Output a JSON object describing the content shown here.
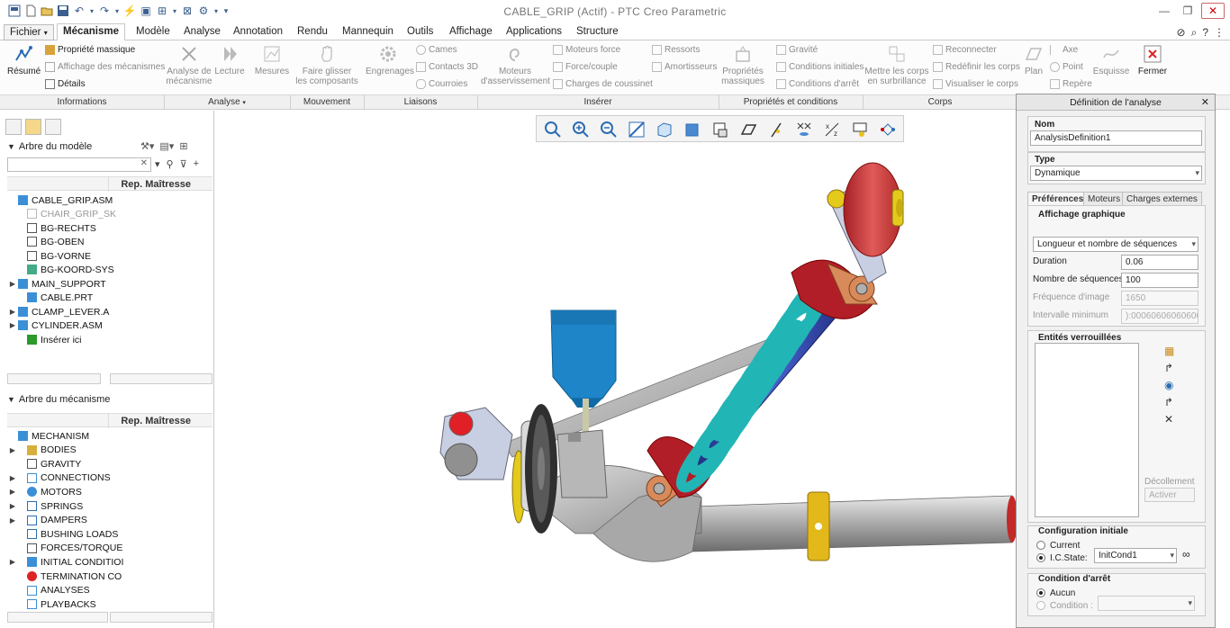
{
  "window": {
    "title": "CABLE_GRIP (Actif) - PTC Creo Parametric"
  },
  "tabs": [
    {
      "label": "Fichier",
      "dropdown": "▾"
    },
    {
      "label": "Mécanisme"
    },
    {
      "label": "Modèle"
    },
    {
      "label": "Analyse"
    },
    {
      "label": "Annotation"
    },
    {
      "label": "Rendu"
    },
    {
      "label": "Mannequin"
    },
    {
      "label": "Outils"
    },
    {
      "label": "Affichage"
    },
    {
      "label": "Applications"
    },
    {
      "label": "Structure"
    }
  ],
  "ribbon": {
    "resume": "Résumé",
    "propriete_massique": "Propriété massique",
    "affichage_mecanismes": "Affichage des mécanismes",
    "details": "Détails",
    "analyse_mecanisme": "Analyse de mécanisme",
    "lecture": "Lecture",
    "mesures": "Mesures",
    "faire_glisser": "Faire glisser les composants",
    "engrenages": "Engrenages",
    "cames": "Cames",
    "contacts_3d": "Contacts 3D",
    "courroies": "Courroies",
    "moteurs_asservissement": "Moteurs d'asservissement",
    "moteurs_force": "Moteurs force",
    "force_couple": "Force/couple",
    "charges_coussinet": "Charges de coussinet",
    "ressorts": "Ressorts",
    "amortisseurs": "Amortisseurs",
    "proprietes_massiques": "Propriétés massiques",
    "gravite": "Gravité",
    "conditions_initiales": "Conditions initiales",
    "conditions_arret": "Conditions d'arrêt",
    "mettre_corps": "Mettre les corps en surbrillance",
    "reconnecter": "Reconnecter",
    "redefinir_corps": "Redéfinir les corps",
    "visualiser_corps": "Visualiser le corps",
    "plan": "Plan",
    "axe": "Axe",
    "point": "Point",
    "repere": "Repère",
    "esquisse": "Esquisse",
    "fermer": "Fermer"
  },
  "groups": [
    "Informations",
    "Analyse",
    "Mouvement",
    "Liaisons",
    "Insérer",
    "Propriétés et conditions",
    "Corps"
  ],
  "model_tree": {
    "header": "Arbre du modèle",
    "column": "Rep. Maîtresse",
    "items": [
      {
        "label": "CABLE_GRIP.ASM",
        "dim": false
      },
      {
        "label": "CHAIR_GRIP_SK",
        "dim": true
      },
      {
        "label": "BG-RECHTS",
        "dim": false
      },
      {
        "label": "BG-OBEN",
        "dim": false
      },
      {
        "label": "BG-VORNE",
        "dim": false
      },
      {
        "label": "BG-KOORD-SYS",
        "dim": false
      },
      {
        "label": "MAIN_SUPPORT",
        "dim": false
      },
      {
        "label": "CABLE.PRT",
        "dim": false
      },
      {
        "label": "CLAMP_LEVER.A",
        "dim": false
      },
      {
        "label": "CYLINDER.ASM",
        "dim": false
      },
      {
        "label": "Insérer ici",
        "dim": false
      }
    ]
  },
  "mech_tree": {
    "header": "Arbre du mécanisme",
    "column": "Rep. Maîtresse",
    "items": [
      {
        "label": "MECHANISM"
      },
      {
        "label": "BODIES"
      },
      {
        "label": "GRAVITY"
      },
      {
        "label": "CONNECTIONS"
      },
      {
        "label": "MOTORS"
      },
      {
        "label": "SPRINGS"
      },
      {
        "label": "DAMPERS"
      },
      {
        "label": "BUSHING LOADS"
      },
      {
        "label": "FORCES/TORQUE"
      },
      {
        "label": "INITIAL CONDITIOI"
      },
      {
        "label": "TERMINATION CO"
      },
      {
        "label": "ANALYSES"
      },
      {
        "label": "PLAYBACKS"
      }
    ]
  },
  "dialog": {
    "title": "Définition de l'analyse",
    "nom_label": "Nom",
    "nom_value": "AnalysisDefinition1",
    "type_label": "Type",
    "type_value": "Dynamique",
    "tabs": [
      "Préférences",
      "Moteurs",
      "Charges externes"
    ],
    "affichage_label": "Affichage graphique",
    "mode_value": "Longueur et nombre de séquences",
    "duration_label": "Duration",
    "duration_value": "0.06",
    "nb_seq_label": "Nombre de séquences",
    "nb_seq_value": "100",
    "freq_label": "Fréquence d'image",
    "freq_value": "1650",
    "intervalle_label": "Intervalle minimum",
    "intervalle_value": "):000606060606061",
    "entites_label": "Entités verrouillées",
    "decollement": "Décollement",
    "activer": "Activer",
    "config_label": "Configuration initiale",
    "current_label": "Current",
    "ic_label": "I.C.State:",
    "ic_value": "InitCond1",
    "arret_label": "Condition d'arrêt",
    "aucun_label": "Aucun",
    "condition_label": "Condition :"
  },
  "colors": {
    "spring": "#22b5b5",
    "rod": "#2b3fa6",
    "cap": "#c0202a",
    "yellow": "#e8c21a",
    "blue_part": "#1e86c8",
    "copper": "#d98a5a"
  }
}
